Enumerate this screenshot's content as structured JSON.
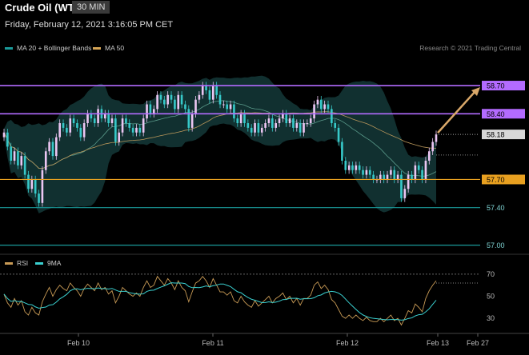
{
  "header": {
    "title": "Crude Oil (WTI)",
    "timeframe": "30 MIN",
    "datetime": "Friday, February 12, 2021 3:16:05 PM CET",
    "credit": "Research © 2021 Trading Central"
  },
  "legend": {
    "ma20_label": "MA 20 + Bollinger Bands",
    "ma50_label": "MA 50",
    "rsi_label": "RSI",
    "nine_ma_label": "9MA"
  },
  "colors": {
    "bg": "#000000",
    "up": "#ecc6f3",
    "down": "#37c9c9",
    "bollinger": "#143838",
    "ma20": "#5a9a8a",
    "ma50": "#b8965a",
    "resistance": "#b36bff",
    "support_orange": "#e8a020",
    "support_teal": "#1a9a9a",
    "arrow": "#d9a86a",
    "rsi": "#c89a55",
    "nine_ma": "#3ad0d0"
  },
  "chart_data": [
    {
      "type": "candlestick",
      "title": "Crude Oil (WTI)",
      "x_ticks": [
        "Feb 10",
        "Feb 11",
        "Feb 12",
        "Feb 13",
        "Feb 27"
      ],
      "ylim": [
        56.98,
        58.76
      ],
      "levels": [
        {
          "value": 58.7,
          "label": "58.70",
          "kind": "resistance"
        },
        {
          "value": 58.4,
          "label": "58.40",
          "kind": "resistance"
        },
        {
          "value": 58.18,
          "label": "58.18",
          "kind": "last"
        },
        {
          "value": 57.7,
          "label": "57.70",
          "kind": "support"
        },
        {
          "value": 57.4,
          "label": "57.40",
          "kind": "support"
        },
        {
          "value": 57.0,
          "label": "57.00",
          "kind": "support"
        }
      ],
      "arrow": {
        "from": 58.18,
        "to": 58.7
      },
      "close": [
        58.2,
        58.05,
        57.9,
        58.0,
        57.85,
        57.95,
        57.75,
        57.6,
        57.7,
        57.55,
        57.45,
        57.8,
        58.0,
        58.1,
        57.95,
        58.15,
        58.3,
        58.25,
        58.2,
        58.35,
        58.3,
        58.25,
        58.15,
        58.3,
        58.4,
        58.35,
        58.3,
        58.45,
        58.35,
        58.4,
        58.3,
        58.35,
        58.1,
        58.2,
        58.35,
        58.3,
        58.25,
        58.2,
        58.25,
        58.2,
        58.35,
        58.5,
        58.4,
        58.45,
        58.6,
        58.55,
        58.5,
        58.6,
        58.55,
        58.45,
        58.6,
        58.5,
        58.45,
        58.25,
        58.4,
        58.55,
        58.6,
        58.7,
        58.65,
        58.55,
        58.7,
        58.6,
        58.5,
        58.5,
        58.45,
        58.5,
        58.35,
        58.3,
        58.4,
        58.3,
        58.25,
        58.2,
        58.3,
        58.2,
        58.25,
        58.3,
        58.35,
        58.25,
        58.3,
        58.35,
        58.4,
        58.3,
        58.35,
        58.25,
        58.3,
        58.2,
        58.3,
        58.3,
        58.35,
        58.5,
        58.55,
        58.45,
        58.5,
        58.45,
        58.3,
        58.25,
        58.1,
        57.9,
        57.8,
        57.85,
        57.8,
        57.85,
        57.8,
        57.75,
        57.8,
        57.75,
        57.7,
        57.7,
        57.75,
        57.7,
        57.75,
        57.8,
        57.7,
        57.75,
        57.5,
        57.6,
        57.75,
        57.7,
        57.85,
        57.8,
        57.7,
        57.9,
        58.0,
        58.1,
        58.18
      ]
    },
    {
      "type": "line",
      "title": "RSI",
      "yticks": [
        30,
        50,
        70
      ],
      "ylim": [
        20,
        75
      ],
      "series": [
        {
          "name": "RSI",
          "values": [
            52,
            44,
            40,
            48,
            42,
            46,
            36,
            33,
            40,
            35,
            33,
            45,
            52,
            58,
            50,
            56,
            60,
            57,
            55,
            62,
            58,
            55,
            50,
            57,
            61,
            58,
            55,
            62,
            56,
            58,
            52,
            55,
            44,
            50,
            58,
            55,
            52,
            50,
            53,
            50,
            58,
            64,
            58,
            60,
            68,
            64,
            60,
            66,
            62,
            56,
            64,
            58,
            55,
            45,
            54,
            62,
            64,
            68,
            64,
            58,
            66,
            60,
            54,
            54,
            51,
            54,
            46,
            44,
            50,
            45,
            42,
            40,
            46,
            41,
            44,
            47,
            50,
            44,
            48,
            50,
            53,
            47,
            50,
            44,
            48,
            42,
            48,
            48,
            51,
            60,
            63,
            57,
            60,
            56,
            47,
            44,
            38,
            32,
            30,
            33,
            30,
            33,
            30,
            28,
            31,
            28,
            27,
            27,
            30,
            27,
            30,
            33,
            28,
            30,
            24,
            30,
            37,
            35,
            43,
            40,
            36,
            48,
            55,
            60,
            64
          ]
        }
      ]
    }
  ]
}
